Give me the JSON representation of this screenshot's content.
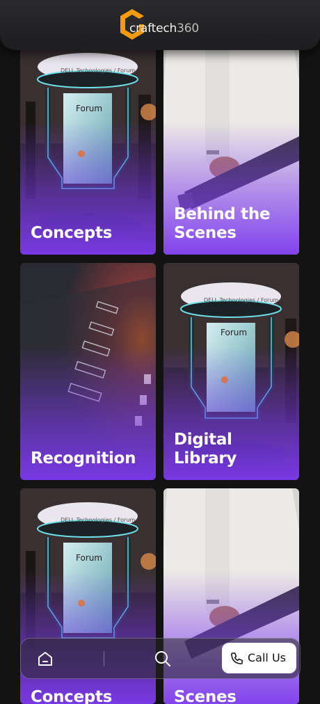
{
  "header": {
    "logo_text": "craftech",
    "logo_suffix": "360"
  },
  "cards": [
    {
      "label": "Concepts",
      "image": "dell-forum-kiosk"
    },
    {
      "label": "Behind the Scenes",
      "image": "man-holding-panel"
    },
    {
      "label": "Recognition",
      "image": "glowing-panel-closeup"
    },
    {
      "label": "Digital Library",
      "image": "dell-forum-kiosk"
    },
    {
      "label": "Concepts",
      "image": "dell-forum-kiosk"
    },
    {
      "label": "Behind the Scenes",
      "image": "man-holding-panel"
    }
  ],
  "kiosk": {
    "ring_text": "DELL Technologies / Forum",
    "screen_title": "Forum"
  },
  "bottom_nav": {
    "home_icon": "home-icon",
    "search_icon": "search-icon",
    "call_label": "Call Us",
    "call_icon": "phone-icon"
  },
  "colors": {
    "accent_purple": "#7c3aed",
    "logo_orange": "#f39c12",
    "background": "#131313"
  }
}
